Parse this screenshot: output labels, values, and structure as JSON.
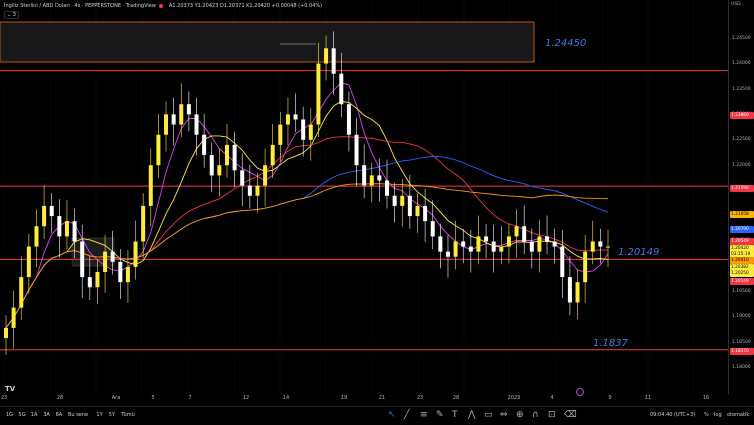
{
  "legend": {
    "symbol": "İngiliz Sterlini / ABD Doları · 4s · PEPPERSTONE · TradingView",
    "ohlc": "A1.20373 Y1.20423 D1.20371 K1.20420 +0.00048 (+0.04%)",
    "collapse_label": "3"
  },
  "levels": [
    {
      "label": "1.24450",
      "price": 1.2445
    },
    {
      "label": "1.20149",
      "price": 1.20149
    },
    {
      "label": "1.1837",
      "price": 1.1837
    }
  ],
  "y_axis": {
    "currency": "USD",
    "ticks": [
      "1.24500",
      "1.24000",
      "1.23500",
      "1.23000",
      "1.22500",
      "1.22000",
      "1.21500",
      "1.21000",
      "1.20500",
      "1.20000",
      "1.19500",
      "1.19000",
      "1.18500",
      "1.18000"
    ],
    "tags": [
      {
        "text": "1.23860",
        "bg": "#f23645",
        "fg": "#ffffff"
      },
      {
        "text": "1.21590",
        "bg": "#f23645",
        "fg": "#ffffff"
      },
      {
        "text": "1.21058",
        "bg": "#ffb300",
        "fg": "#000000"
      },
      {
        "text": "1.20790",
        "bg": "#2962ff",
        "fg": "#ffffff"
      },
      {
        "text": "1.20549",
        "bg": "#f23645",
        "fg": "#ffffff"
      },
      {
        "text": "1.20420",
        "bg": "#ffeb3b",
        "fg": "#000000"
      },
      {
        "text": "03:15:19",
        "bg": "#ffeb3b",
        "fg": "#000000"
      },
      {
        "text": "1.20410",
        "bg": "#ff9800",
        "fg": "#000000"
      },
      {
        "text": "1.20382",
        "bg": "#ffeb3b",
        "fg": "#000000"
      },
      {
        "text": "1.20250",
        "bg": "#ffeb3b",
        "fg": "#000000"
      },
      {
        "text": "1.20149",
        "bg": "#f23645",
        "fg": "#ffffff"
      },
      {
        "text": "1.18370",
        "bg": "#f23645",
        "fg": "#ffffff"
      }
    ]
  },
  "x_axis": [
    "23",
    "28",
    "Ara",
    "5",
    "7",
    "12",
    "14",
    "19",
    "21",
    "23",
    "28",
    "2023",
    "4",
    "9",
    "11",
    "16"
  ],
  "bottom_bar": {
    "timeframes": [
      "1G",
      "5G",
      "1A",
      "3A",
      "6A",
      "Bu sene",
      "1Y",
      "5Y",
      "Tümü"
    ],
    "tools": [
      "cursor-icon",
      "trend-line-icon",
      "fib-icon",
      "brush-icon",
      "text-icon",
      "pattern-icon",
      "shapes-icon",
      "measure-icon",
      "zoom-icon",
      "magnet-icon",
      "lock-icon",
      "trash-icon"
    ],
    "clock": "09:04:40 (UTC+3)",
    "percent": "%",
    "log": "log",
    "auto": "otomatik"
  },
  "colors": {
    "background": "#000000",
    "bull": "#ffeb3b",
    "bear": "#ffffff",
    "level": "#f23645",
    "ma_blue": "#2962ff",
    "ma_orange": "#ff9800",
    "label_blue": "#3d7be8"
  },
  "chart_data": {
    "type": "candlestick",
    "title": "İngiliz Sterlini / ABD Doları · 4s",
    "price_range": [
      1.175,
      1.2525
    ],
    "horizontal_levels": [
      1.2386,
      1.2159,
      1.20149,
      1.1837
    ],
    "zones": [
      [
        1.2445,
        1.2493
      ]
    ],
    "close_series": [
      1.188,
      1.192,
      1.198,
      1.204,
      1.208,
      1.212,
      1.21,
      1.206,
      1.209,
      1.205,
      1.198,
      1.196,
      1.199,
      1.203,
      1.201,
      1.197,
      1.2,
      1.205,
      1.212,
      1.22,
      1.226,
      1.23,
      1.228,
      1.232,
      1.23,
      1.226,
      1.222,
      1.218,
      1.22,
      1.224,
      1.219,
      1.216,
      1.214,
      1.216,
      1.22,
      1.224,
      1.228,
      1.23,
      1.229,
      1.225,
      1.228,
      1.24,
      1.243,
      1.238,
      1.232,
      1.226,
      1.22,
      1.216,
      1.218,
      1.217,
      1.214,
      1.212,
      1.214,
      1.21,
      1.212,
      1.209,
      1.206,
      1.203,
      1.202,
      1.205,
      1.204,
      1.203,
      1.206,
      1.205,
      1.203,
      1.204,
      1.206,
      1.208,
      1.205,
      1.203,
      1.206,
      1.205,
      1.204,
      1.198,
      1.193,
      1.197,
      1.203,
      1.205,
      1.204,
      1.204
    ]
  }
}
